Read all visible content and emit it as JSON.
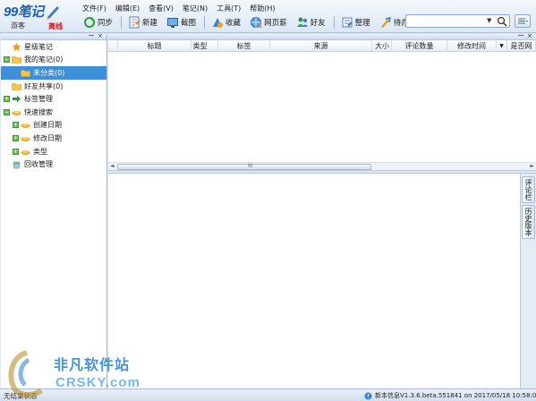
{
  "app": {
    "brand": "99笔记",
    "user": "游客",
    "mode": "离线"
  },
  "menu": [
    "文件(F)",
    "编辑(E)",
    "查看(V)",
    "笔记(N)",
    "工具(T)",
    "帮助(H)"
  ],
  "toolbar": {
    "sync": "同步",
    "new": "新建",
    "screenshot": "截图",
    "collect": "收藏",
    "webpage": "网页薪",
    "friends": "好友",
    "organize": "整理",
    "todo": "待办"
  },
  "search": {
    "value": "",
    "dropdown_glyph": "▼"
  },
  "tree": [
    {
      "label": "星级笔记",
      "icon": "star-icon",
      "indent": 0,
      "expander": ""
    },
    {
      "label": "我的笔记(0)",
      "icon": "folder-icon",
      "indent": 0,
      "expander": "−"
    },
    {
      "label": "未分类(0)",
      "icon": "folder-icon",
      "indent": 1,
      "expander": "",
      "selected": true
    },
    {
      "label": "好友共享(0)",
      "icon": "folder-icon",
      "indent": 0,
      "expander": ""
    },
    {
      "label": "标签管理",
      "icon": "arrow-right-icon",
      "indent": 0,
      "expander": "+"
    },
    {
      "label": "快速搜索",
      "icon": "dish-icon",
      "indent": 0,
      "expander": "−"
    },
    {
      "label": "创建日期",
      "icon": "dish-icon",
      "indent": 1,
      "expander": "+"
    },
    {
      "label": "修改日期",
      "icon": "dish-icon",
      "indent": 1,
      "expander": "+"
    },
    {
      "label": "类型",
      "icon": "dish-icon",
      "indent": 1,
      "expander": "+"
    },
    {
      "label": "回收管理",
      "icon": "recycle-icon",
      "indent": 0,
      "expander": ""
    }
  ],
  "columns": [
    {
      "label": "",
      "key": "blank"
    },
    {
      "label": "标题",
      "key": "title"
    },
    {
      "label": "类型",
      "key": "type"
    },
    {
      "label": "标签",
      "key": "tags"
    },
    {
      "label": "来源",
      "key": "source"
    },
    {
      "label": "大小",
      "key": "size"
    },
    {
      "label": "评论数量",
      "key": "comments"
    },
    {
      "label": "修改时间",
      "key": "modified"
    },
    {
      "label": "▼",
      "key": "sort"
    },
    {
      "label": "是否网",
      "key": "web"
    }
  ],
  "scrollbar": {
    "grip": "III",
    "left_arrow": "◄",
    "right_arrow": "►"
  },
  "side_tabs": [
    "评论栏",
    "历史版本"
  ],
  "status": {
    "left": "无结果状态",
    "right": "新本信息V1.3.6.beta.551841 on 2017/05/18 10:58:03"
  },
  "watermark": {
    "line1": "非凡软件站",
    "line2": "CRSKY.com"
  },
  "colors": {
    "selection": "#3f8fd8",
    "accent": "#1f5fb0",
    "offline": "#e01010"
  }
}
